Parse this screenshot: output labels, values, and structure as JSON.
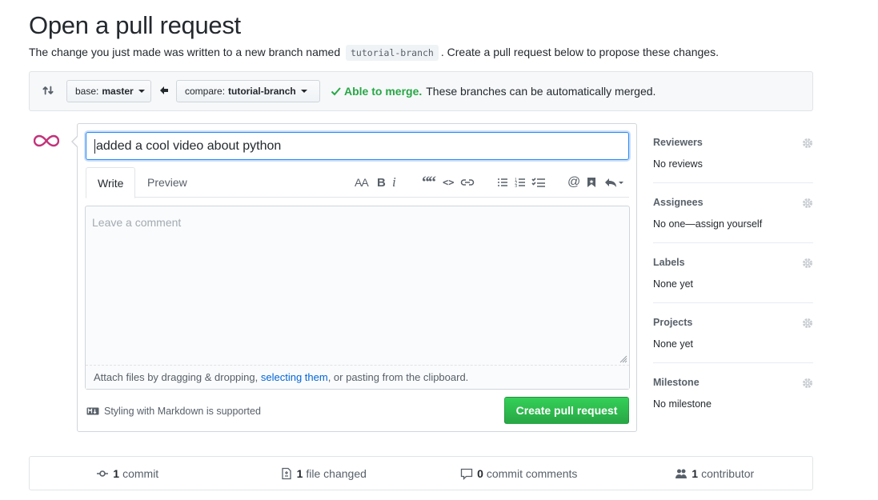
{
  "header": {
    "title": "Open a pull request",
    "subtitle_pre": "The change you just made was written to a new branch named",
    "branch_code": "tutorial-branch",
    "subtitle_post": ". Create a pull request below to propose these changes."
  },
  "range": {
    "base_label": "base:",
    "base_value": "master",
    "compare_label": "compare:",
    "compare_value": "tutorial-branch",
    "merge_ok": "Able to merge.",
    "merge_text": "These branches can be automatically merged."
  },
  "form": {
    "title_value": "added a cool video about python",
    "tabs": [
      {
        "label": "Write"
      },
      {
        "label": "Preview"
      }
    ],
    "toolbar": {
      "header": "AA",
      "bold": "B",
      "italic": "i",
      "quote": "““",
      "code": "<>",
      "mention": "@"
    },
    "comment_placeholder": "Leave a comment",
    "attach_pre": "Attach files by dragging & dropping, ",
    "attach_link": "selecting them",
    "attach_post": ", or pasting from the clipboard.",
    "markdown_note": "Styling with Markdown is supported",
    "submit_label": "Create pull request"
  },
  "sidebar": {
    "sections": [
      {
        "title": "Reviewers",
        "value": "No reviews"
      },
      {
        "title": "Assignees",
        "value": "No one—assign yourself"
      },
      {
        "title": "Labels",
        "value": "None yet"
      },
      {
        "title": "Projects",
        "value": "None yet"
      },
      {
        "title": "Milestone",
        "value": "No milestone"
      }
    ]
  },
  "summary": {
    "commits_count": "1",
    "commits_label": "commit",
    "files_count": "1",
    "files_label": "file changed",
    "comments_count": "0",
    "comments_label": "commit comments",
    "contributors_count": "1",
    "contributors_label": "contributor"
  },
  "colors": {
    "accent": "#0366d6",
    "success": "#28a745",
    "avatar": "#c2337a"
  }
}
